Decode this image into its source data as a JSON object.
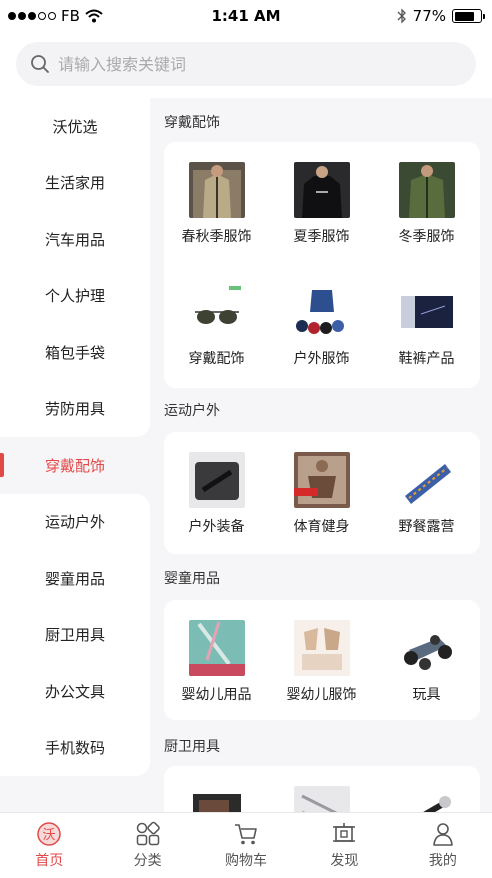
{
  "status_bar": {
    "carrier": "FB",
    "time": "1:41 AM",
    "battery": "77%",
    "battery_level": 0.77
  },
  "search": {
    "placeholder": "请输入搜索关键词"
  },
  "sidebar": {
    "items": [
      {
        "label": "沃优选"
      },
      {
        "label": "生活家用"
      },
      {
        "label": "汽车用品"
      },
      {
        "label": "个人护理"
      },
      {
        "label": "箱包手袋"
      },
      {
        "label": "劳防用具"
      },
      {
        "label": "穿戴配饰",
        "active": true
      },
      {
        "label": "运动户外"
      },
      {
        "label": "婴童用品"
      },
      {
        "label": "厨卫用具"
      },
      {
        "label": "办公文具"
      },
      {
        "label": "手机数码"
      }
    ]
  },
  "main": {
    "sections": [
      {
        "title": "穿戴配饰",
        "products": [
          {
            "label": "春秋季服饰",
            "icon": "jacket-image"
          },
          {
            "label": "夏季服饰",
            "icon": "tshirt-image"
          },
          {
            "label": "冬季服饰",
            "icon": "coat-image"
          },
          {
            "label": "穿戴配饰",
            "icon": "sunglasses-image"
          },
          {
            "label": "户外服饰",
            "icon": "hoodies-image"
          },
          {
            "label": "鞋裤产品",
            "icon": "shoebox-image"
          }
        ]
      },
      {
        "title": "运动户外",
        "products": [
          {
            "label": "户外装备",
            "icon": "gear-case-image"
          },
          {
            "label": "体育健身",
            "icon": "fitness-image"
          },
          {
            "label": "野餐露营",
            "icon": "picnic-mat-image"
          }
        ]
      },
      {
        "title": "婴童用品",
        "products": [
          {
            "label": "婴幼儿用品",
            "icon": "baby-goods-image"
          },
          {
            "label": "婴幼儿服饰",
            "icon": "baby-clothes-image"
          },
          {
            "label": "玩具",
            "icon": "rc-car-image"
          }
        ]
      },
      {
        "title": "厨卫用具",
        "products": []
      }
    ]
  },
  "tabbar": {
    "tabs": [
      {
        "label": "首页",
        "icon": "home-icon",
        "active": true
      },
      {
        "label": "分类",
        "icon": "category-icon"
      },
      {
        "label": "购物车",
        "icon": "cart-icon"
      },
      {
        "label": "发现",
        "icon": "discover-icon"
      },
      {
        "label": "我的",
        "icon": "profile-icon"
      }
    ]
  },
  "colors": {
    "accent": "#e24a4a",
    "page_background": "#f6f5f7",
    "card": "#ffffff"
  }
}
